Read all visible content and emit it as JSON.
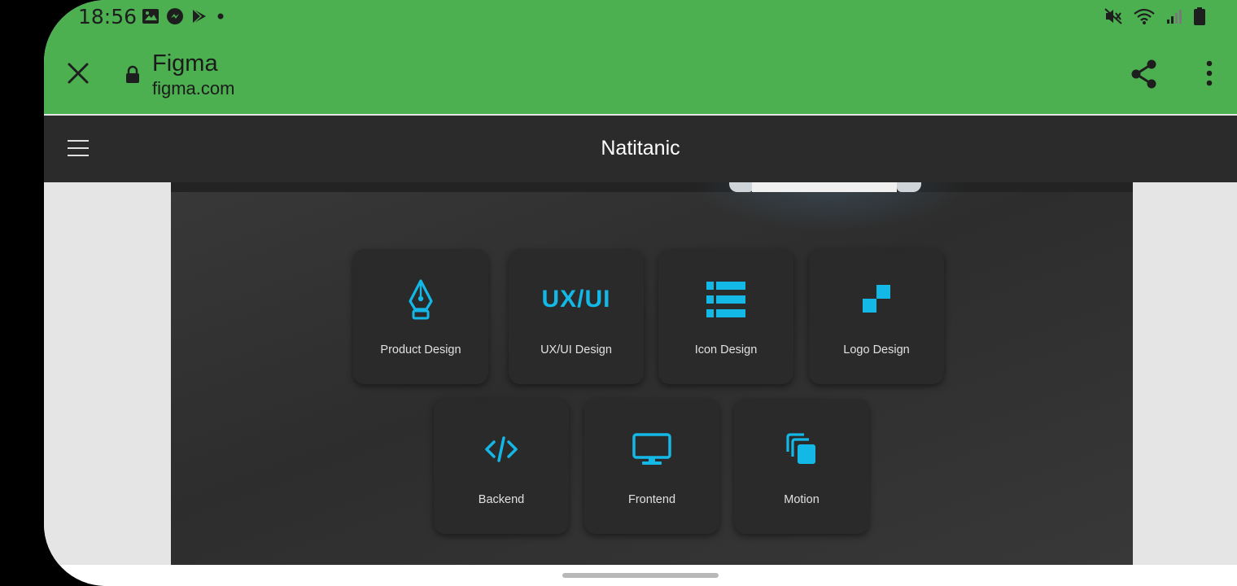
{
  "status_bar": {
    "time": "18:56",
    "left_icons": [
      "image-icon",
      "messenger-icon",
      "play-store-icon",
      "dot-icon"
    ],
    "right_icons": [
      "mute-icon",
      "wifi-icon",
      "signal-icon",
      "battery-icon"
    ]
  },
  "browser": {
    "title": "Figma",
    "url": "figma.com",
    "close_icon": "close-icon",
    "lock_icon": "lock-icon",
    "share_icon": "share-icon",
    "menu_icon": "more-vert-icon"
  },
  "site": {
    "brand": "Natitanic",
    "menu_icon": "hamburger-icon",
    "services": [
      {
        "label": "Product Design",
        "icon": "pen-nib-icon"
      },
      {
        "label": "UX/UI Design",
        "icon": "ux-ui-text-icon",
        "icon_text": "UX/UI"
      },
      {
        "label": "Icon Design",
        "icon": "list-icon"
      },
      {
        "label": "Logo Design",
        "icon": "squares-icon"
      },
      {
        "label": "Backend",
        "icon": "code-icon"
      },
      {
        "label": "Frontend",
        "icon": "monitor-icon"
      },
      {
        "label": "Motion",
        "icon": "layers-icon"
      }
    ]
  },
  "colors": {
    "browser_bar": "#4caf50",
    "site_header": "#2b2b2b",
    "card": "#2a2a2a",
    "accent": "#14b8e6"
  }
}
